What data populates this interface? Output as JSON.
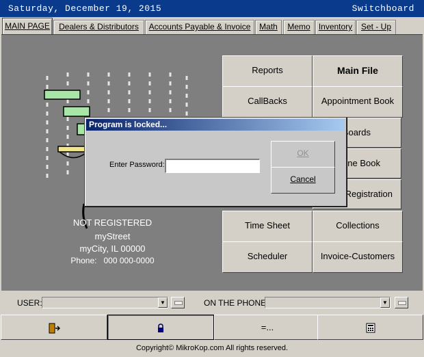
{
  "window": {
    "date": "Saturday, December 19, 2015",
    "app_name": "Switchboard"
  },
  "tabs": [
    {
      "label": "MAIN PAGE",
      "active": true
    },
    {
      "label": "Dealers & Distributors"
    },
    {
      "label": "Accounts Payable & Invoice"
    },
    {
      "label": "Math"
    },
    {
      "label": "Memo"
    },
    {
      "label": "Inventory"
    },
    {
      "label": "Set - Up"
    }
  ],
  "grid": {
    "buttons": [
      {
        "label": "Reports"
      },
      {
        "label": "Main File"
      },
      {
        "label": "CallBacks"
      },
      {
        "label": "Appointment Book"
      },
      {
        "label": "Boards"
      },
      {
        "label": "one Book"
      },
      {
        "label": "Registration"
      },
      {
        "label": "Time Sheet"
      },
      {
        "label": "Collections"
      },
      {
        "label": "Scheduler"
      },
      {
        "label": "Invoice-Customers"
      }
    ]
  },
  "company": {
    "status": "NOT REGISTERED",
    "street": "myStreet",
    "city": "myCity, IL 00000",
    "phone_label": "Phone:",
    "phone": "000 000-0000"
  },
  "dialog": {
    "title": "Program is locked...",
    "password_label": "Enter Password:",
    "password_value": "",
    "ok_label": "OK",
    "cancel_label": "Cancel"
  },
  "userbar": {
    "user_label": "USER:",
    "user_value": "",
    "phone_label": "ON THE PHONE:",
    "phone_value": ""
  },
  "bottom_buttons": [
    {
      "icon": "exit-door-icon"
    },
    {
      "icon": "lock-icon"
    },
    {
      "label": "=..."
    },
    {
      "icon": "calculator-icon"
    }
  ],
  "footer": {
    "copyright": "Copyright© MikroKop.com All rights reserved."
  },
  "colors": {
    "titlebar": "#0a3a8c",
    "panel": "#7f7f7f",
    "face": "#d4d0c8",
    "logo_green": "#a8e6a8"
  }
}
